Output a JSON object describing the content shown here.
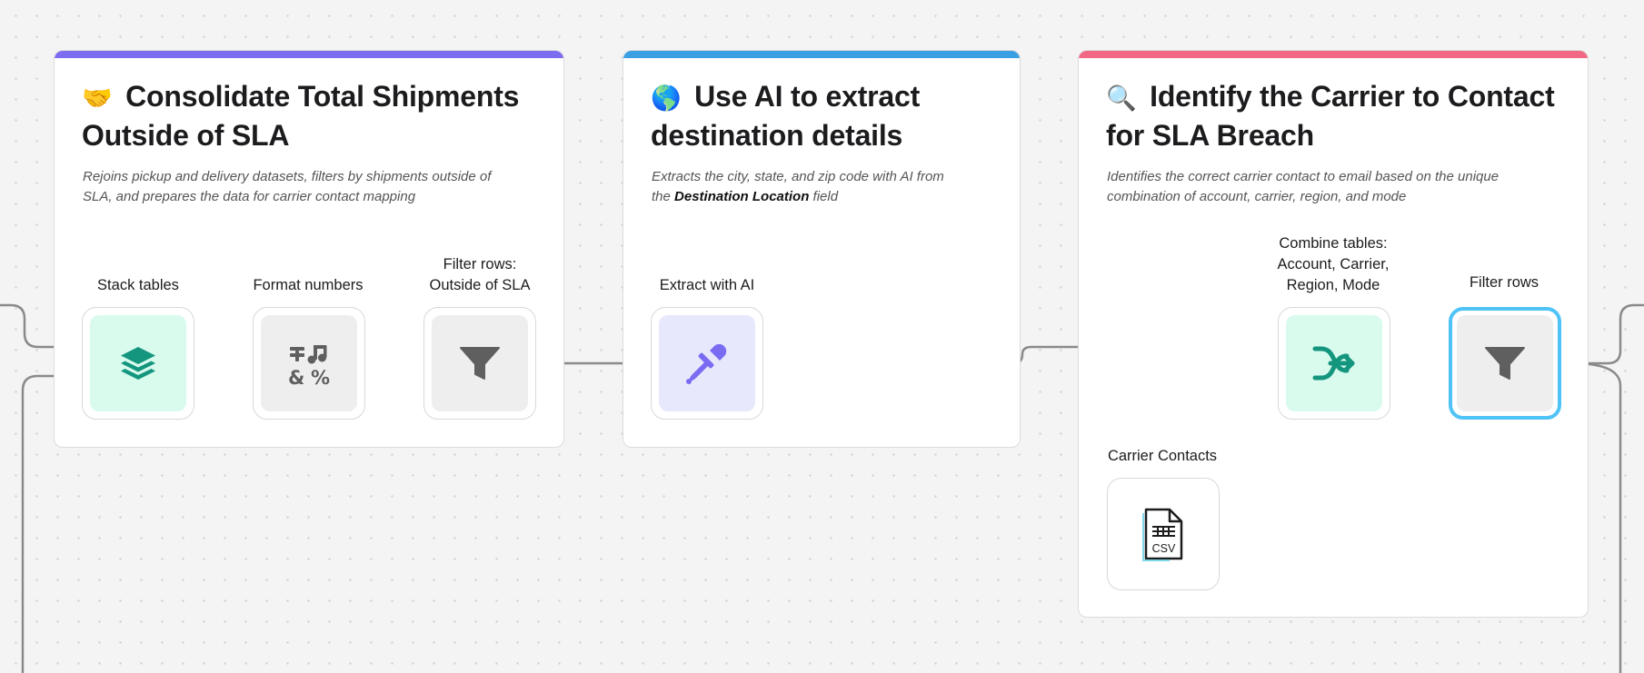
{
  "colors": {
    "purple_bar": "#7b6cf0",
    "blue_bar": "#3b9fe3",
    "pink_bar": "#f06884",
    "teal_tile": "#d8fbee",
    "teal_icon": "#14967e",
    "gray_tile": "#eeeeee",
    "gray_icon": "#5f5f5f",
    "lavender_tile": "#e8e8fd",
    "purple_icon": "#7a6cf2",
    "selected_border": "#4fc3f7",
    "connector": "#8a8a8a"
  },
  "groups": [
    {
      "emoji": "🤝",
      "title_line1": "Consolidate Total Shipments",
      "title_line2": "Outside of SLA",
      "desc_line1": "Rejoins pickup and delivery datasets, filters by shipments outside of",
      "desc_line2": "SLA, and prepares the data for carrier contact mapping"
    },
    {
      "emoji": "🌎",
      "title_line1": "Use AI to extract",
      "title_line2": "destination details",
      "desc_line1": "Extracts the city, state, and zip code with AI from",
      "desc_line2_pre": "the ",
      "desc_line2_bold": "Destination Location",
      "desc_line2_post": " field"
    },
    {
      "emoji": "🔍",
      "title_line1": "Identify the Carrier to Contact",
      "title_line2": "for SLA Breach",
      "desc_line1": "Identifies the correct carrier contact to email based on the unique",
      "desc_line2": "combination of account, carrier, region, and mode"
    }
  ],
  "nodes": {
    "stack_tables": {
      "label": "Stack tables",
      "icon": "layers-icon"
    },
    "format_numbers": {
      "label": "Format numbers",
      "icon": "format-numbers-icon"
    },
    "filter_sla": {
      "label_line1": "Filter rows:",
      "label_line2": "Outside of SLA",
      "icon": "funnel-icon"
    },
    "extract_ai": {
      "label": "Extract with AI",
      "icon": "eyedropper-icon"
    },
    "combine": {
      "label_line1": "Combine tables:",
      "label_line2": "Account, Carrier,",
      "label_line3": "Region, Mode",
      "icon": "merge-arrow-icon"
    },
    "filter_rows": {
      "label": "Filter rows",
      "icon": "funnel-icon"
    },
    "carrier_contacts": {
      "label": "Carrier Contacts",
      "icon": "csv-file-icon",
      "file_type": "CSV"
    }
  }
}
